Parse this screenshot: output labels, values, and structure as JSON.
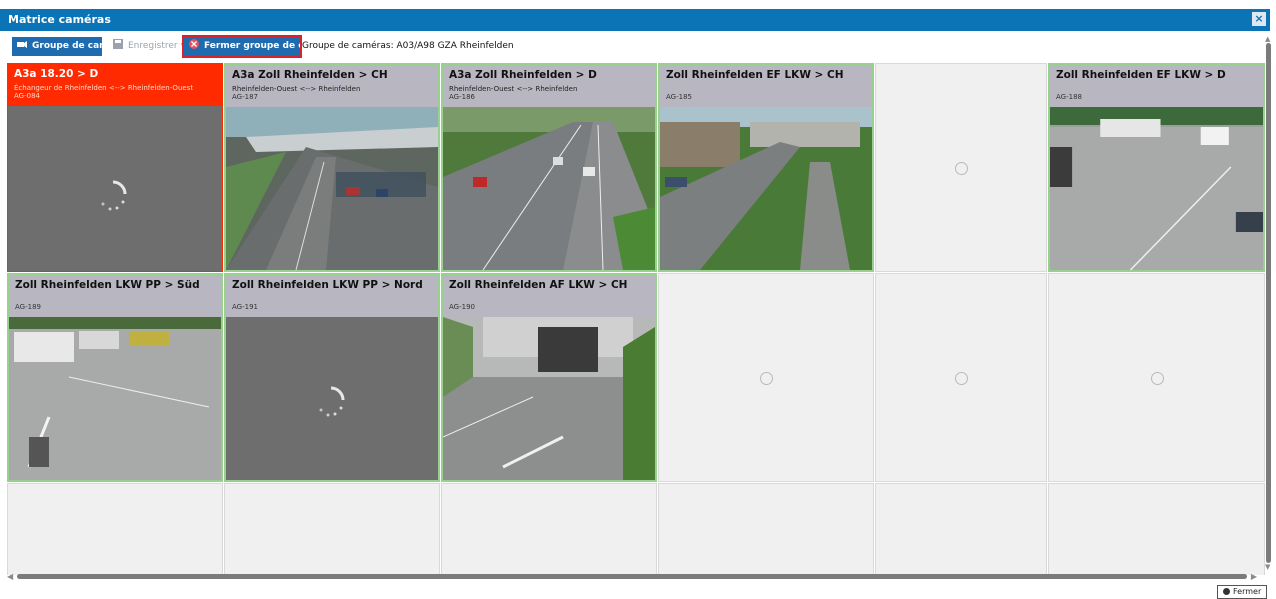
{
  "window": {
    "title": "Matrice caméras",
    "close_icon": "×"
  },
  "toolbar": {
    "group_button": "Groupe de caméras",
    "save_button": "Enregistrer vue",
    "close_group_button": "Fermer groupe de caméras",
    "group_label": "Groupe de caméras: A03/A98 GZA Rheinfelden"
  },
  "cameras": [
    {
      "title": "A3a 18.20 > D",
      "desc": "Échangeur de Rheinfelden <--> Rheinfelden-Ouest",
      "id": "AG-084"
    },
    {
      "title": "A3a Zoll Rheinfelden > CH",
      "desc": "Rheinfelden-Ouest <--> Rheinfelden",
      "id": "AG-187"
    },
    {
      "title": "A3a Zoll Rheinfelden > D",
      "desc": "Rheinfelden-Ouest <--> Rheinfelden",
      "id": "AG-186"
    },
    {
      "title": "Zoll Rheinfelden EF LKW > CH",
      "desc": "",
      "id": "AG-185"
    },
    {
      "title": "Zoll Rheinfelden EF LKW > D",
      "desc": "",
      "id": "AG-188"
    },
    {
      "title": "Zoll Rheinfelden LKW PP > Süd",
      "desc": "",
      "id": "AG-189"
    },
    {
      "title": "Zoll Rheinfelden LKW PP > Nord",
      "desc": "",
      "id": "AG-191"
    },
    {
      "title": "Zoll Rheinfelden AF LKW > CH",
      "desc": "",
      "id": "AG-190"
    }
  ],
  "footer": {
    "close_button": "Fermer"
  },
  "colors": {
    "titlebar": "#0a74b7",
    "alert": "#ff2a00",
    "active_border": "#98d08e",
    "button": "#1f6bb0"
  }
}
